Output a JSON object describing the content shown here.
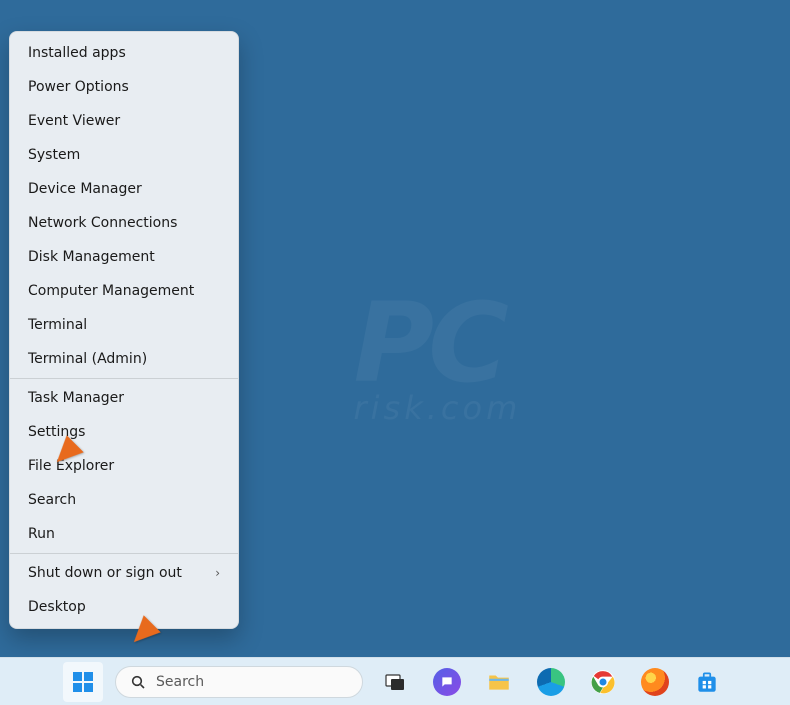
{
  "watermark": {
    "main": "PC",
    "sub": "risk.com"
  },
  "winx": {
    "groups": [
      [
        {
          "label": "Installed apps",
          "submenu": false
        },
        {
          "label": "Power Options",
          "submenu": false
        },
        {
          "label": "Event Viewer",
          "submenu": false
        },
        {
          "label": "System",
          "submenu": false
        },
        {
          "label": "Device Manager",
          "submenu": false
        },
        {
          "label": "Network Connections",
          "submenu": false
        },
        {
          "label": "Disk Management",
          "submenu": false
        },
        {
          "label": "Computer Management",
          "submenu": false
        },
        {
          "label": "Terminal",
          "submenu": false
        },
        {
          "label": "Terminal (Admin)",
          "submenu": false
        }
      ],
      [
        {
          "label": "Task Manager",
          "submenu": false
        },
        {
          "label": "Settings",
          "submenu": false
        },
        {
          "label": "File Explorer",
          "submenu": false
        },
        {
          "label": "Search",
          "submenu": false
        },
        {
          "label": "Run",
          "submenu": false
        }
      ],
      [
        {
          "label": "Shut down or sign out",
          "submenu": true
        },
        {
          "label": "Desktop",
          "submenu": false
        }
      ]
    ]
  },
  "taskbar": {
    "search_placeholder": "Search",
    "icons": {
      "start": "start-icon",
      "taskview": "taskview-icon",
      "chat": "chat-icon",
      "explorer": "file-explorer-icon",
      "edge": "edge-icon",
      "chrome": "chrome-icon",
      "firefox": "firefox-icon",
      "store": "store-icon"
    }
  },
  "annotations": {
    "arrow_settings": "points to Settings menu item",
    "arrow_start": "points to Start button"
  }
}
